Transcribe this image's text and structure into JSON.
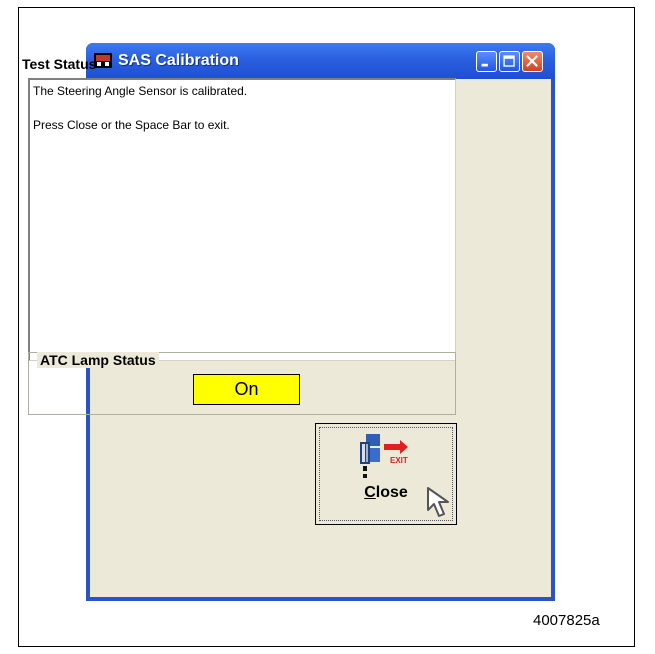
{
  "window": {
    "title": "SAS Calibration"
  },
  "test_status": {
    "label": "Test Status",
    "lines": [
      "The Steering Angle Sensor is calibrated.",
      "Press Close or the Space Bar to exit."
    ]
  },
  "atc_lamp": {
    "label": "ATC Lamp Status",
    "value": "On",
    "color": "#ffff00"
  },
  "close_button": {
    "label_first": "C",
    "label_rest": "lose",
    "icon_text": "EXIT"
  },
  "figure_id": "4007825a"
}
